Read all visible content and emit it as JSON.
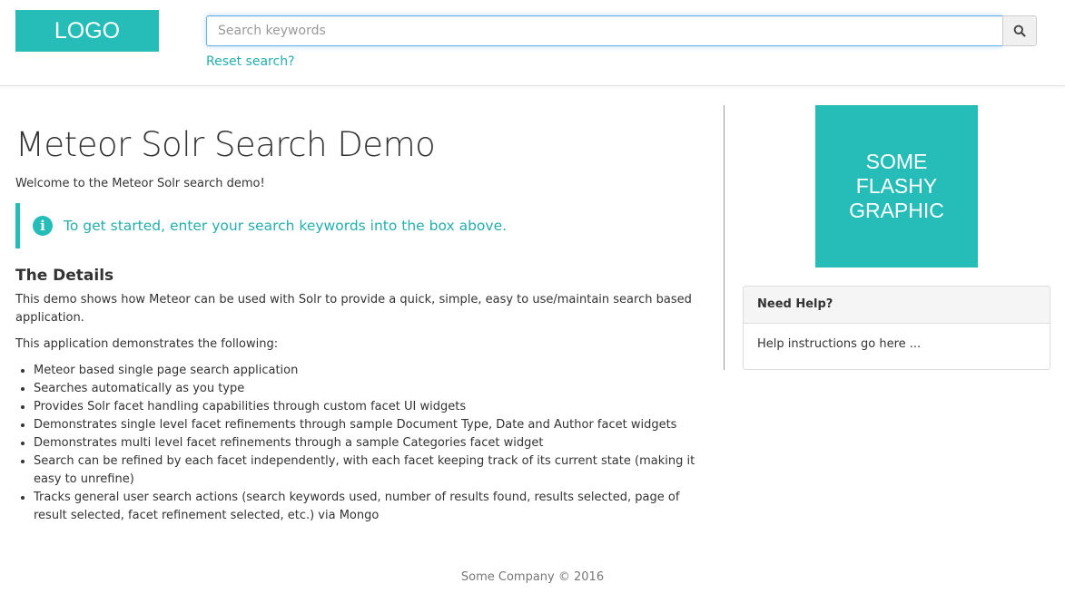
{
  "header": {
    "logo_text": "LOGO",
    "search": {
      "placeholder": "Search keywords",
      "value": ""
    },
    "search_button_icon": "search-icon",
    "reset_link": "Reset search?"
  },
  "main": {
    "title": "Meteor Solr Search Demo",
    "welcome": "Welcome to the Meteor Solr search demo!",
    "callout": {
      "icon": "info-icon",
      "text": "To get started, enter your search keywords into the box above."
    },
    "details_title": "The Details",
    "details_paragraph": "This demo shows how Meteor can be used with Solr to provide a quick, simple, easy to use/maintain search based application.",
    "demonstrates_intro": "This application demonstrates the following:",
    "features": [
      "Meteor based single page search application",
      "Searches automatically as you type",
      "Provides Solr facet handling capabilities through custom facet UI widgets",
      "Demonstrates single level facet refinements through sample Document Type, Date and Author facet widgets",
      "Demonstrates multi level facet refinements through a sample Categories facet widget",
      "Search can be refined by each facet independently, with each facet keeping track of its current state (making it easy to unrefine)",
      "Tracks general user search actions (search keywords used, number of results found, results selected, page of result selected, facet refinement selected, etc.) via Mongo"
    ]
  },
  "sidebar": {
    "graphic_text": "SOME\nFLASHY\nGRAPHIC",
    "help_panel": {
      "heading": "Need Help?",
      "body": "Help instructions go here ..."
    }
  },
  "footer": {
    "text": "Some Company © 2016"
  },
  "colors": {
    "accent": "#26bdb9",
    "link": "#26aeac"
  }
}
